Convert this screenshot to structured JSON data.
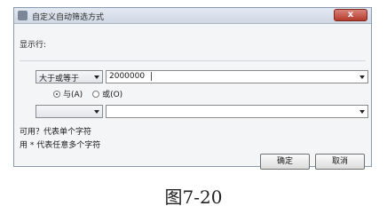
{
  "window": {
    "title": "自定义自动筛选方式",
    "close_glyph": "x"
  },
  "dialog": {
    "section_label": "显示行:",
    "condition1": {
      "operator": "大于或等于",
      "value": "2000000"
    },
    "logic": {
      "and_label": "与(A)",
      "or_label": "或(O)",
      "selected": "and"
    },
    "condition2": {
      "operator": "",
      "value": ""
    },
    "hints": {
      "line1": "可用？代表单个字符",
      "line2": "用 * 代表任意多个字符"
    },
    "buttons": {
      "ok": "确定",
      "cancel": "取消"
    }
  },
  "caption": "图7-20"
}
